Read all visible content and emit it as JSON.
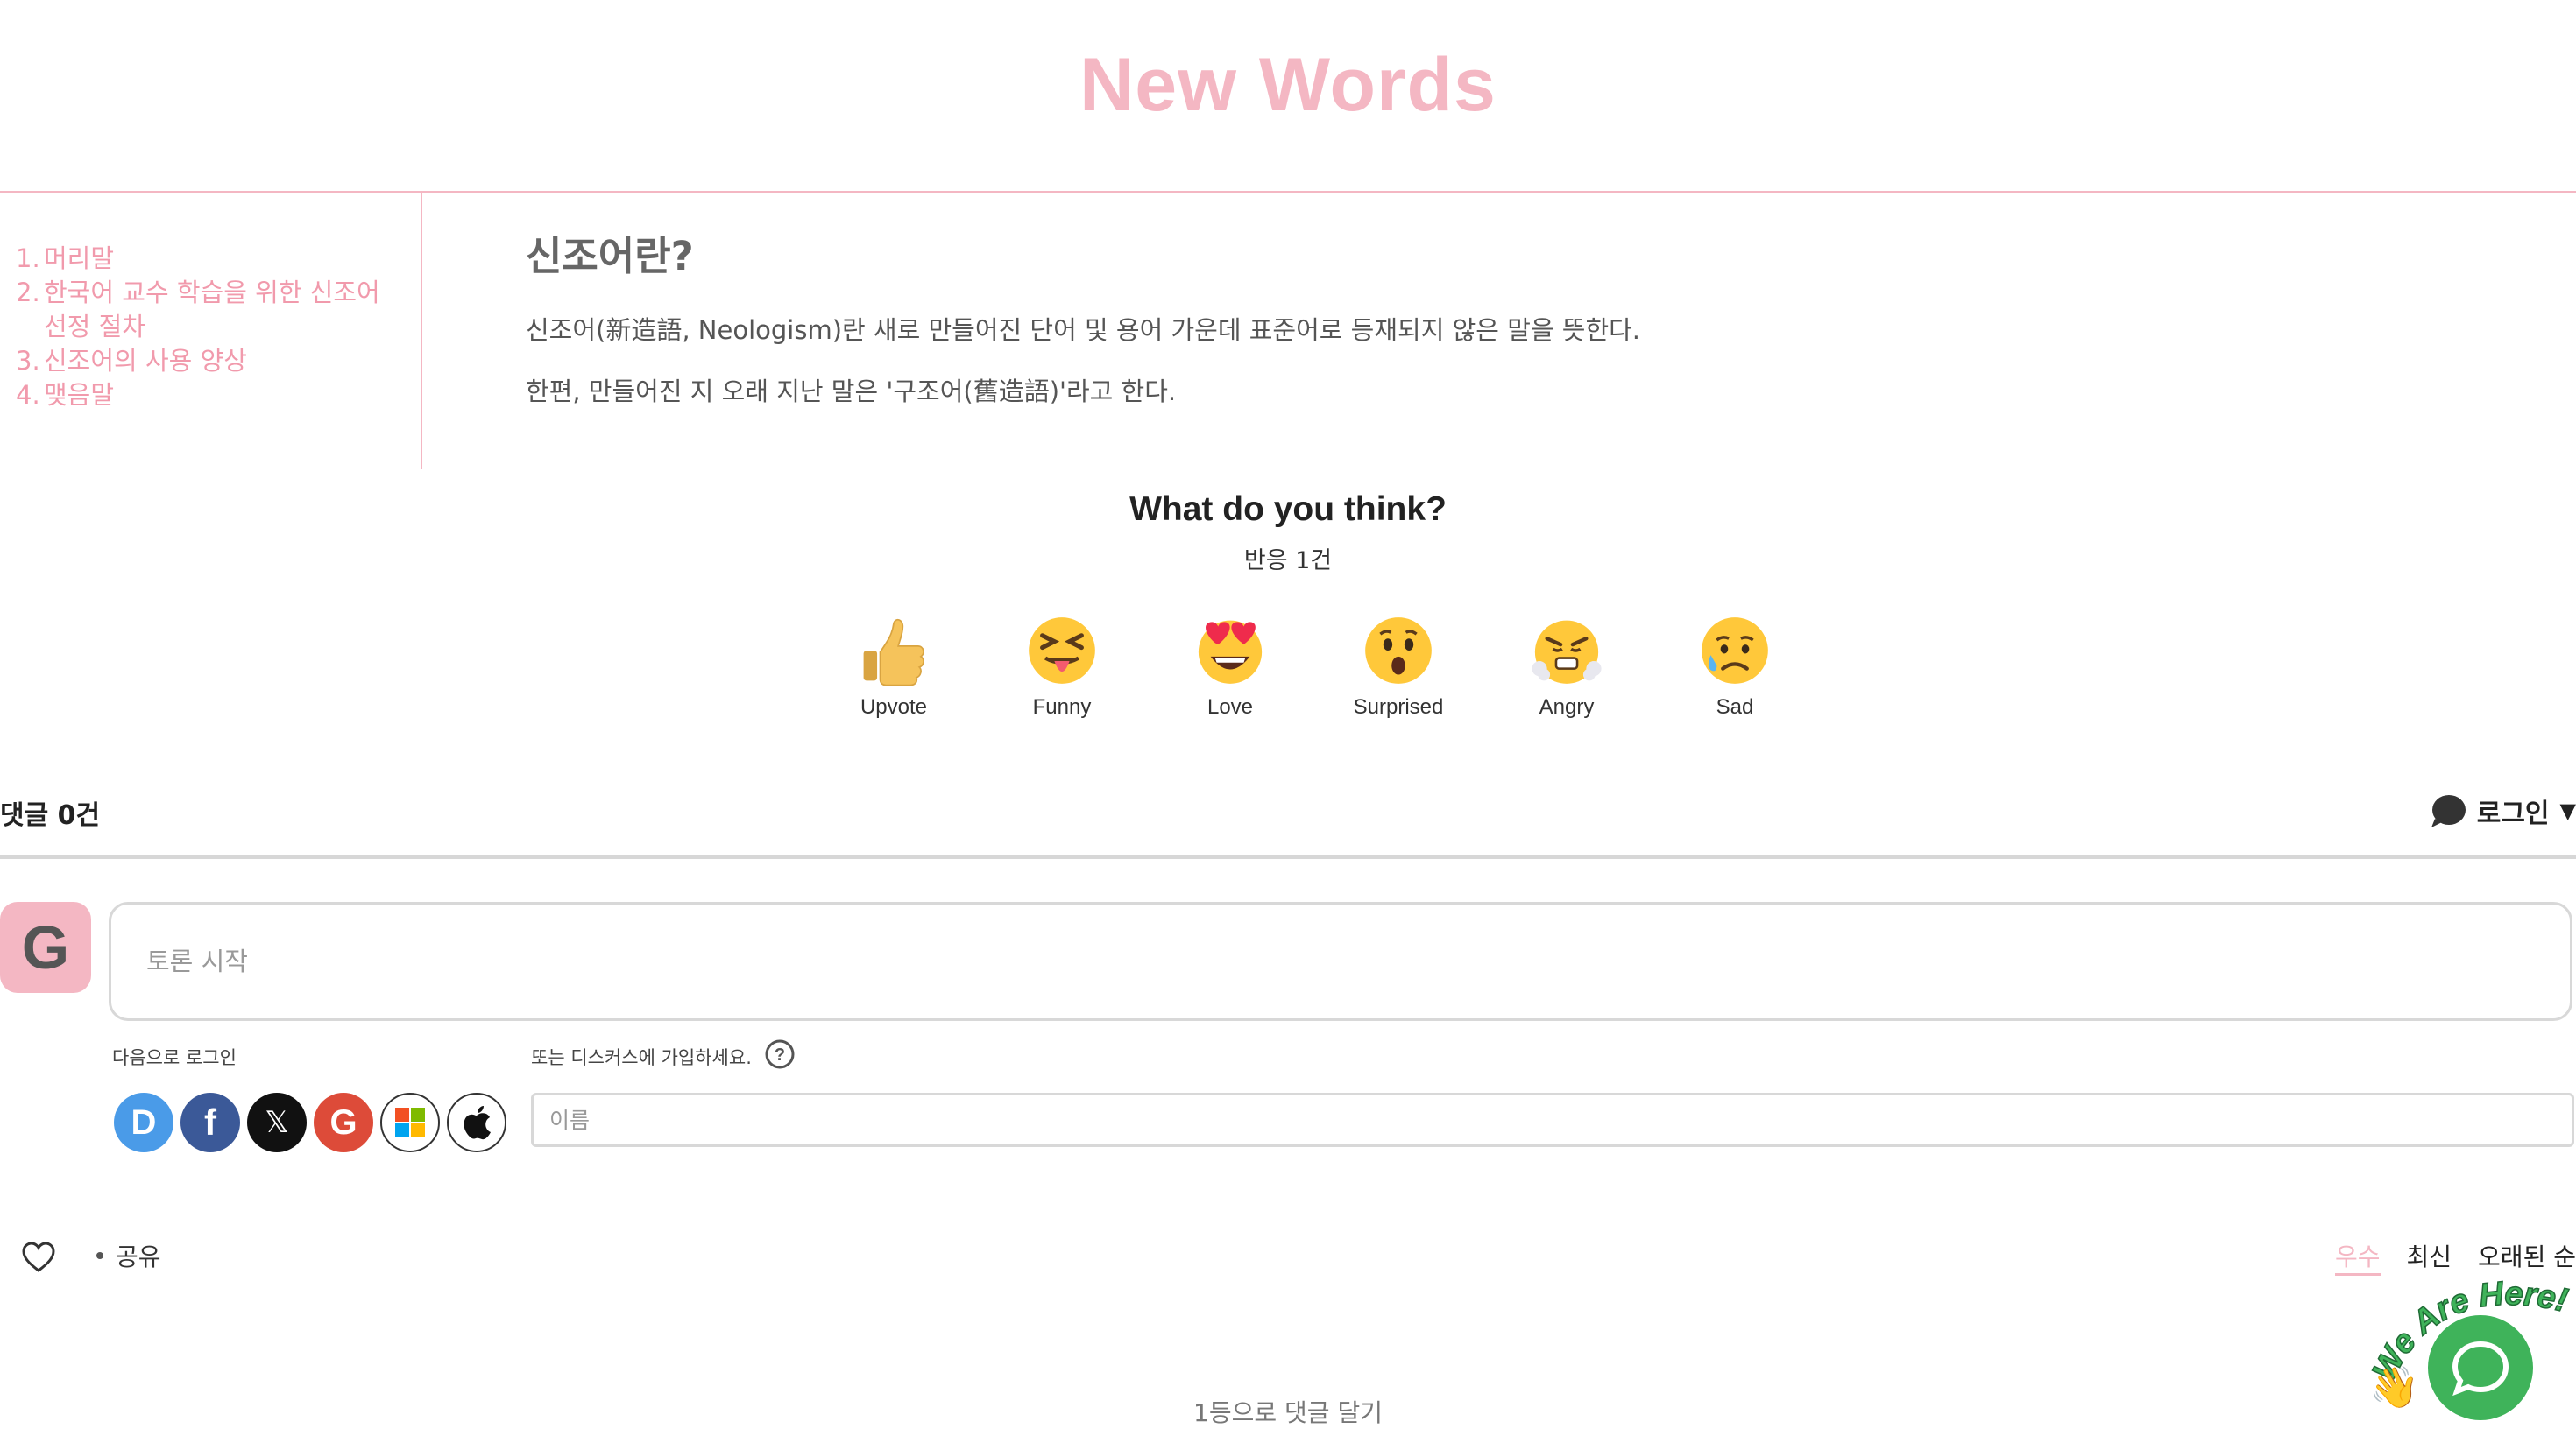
{
  "header": {
    "title": "New Words"
  },
  "toc": {
    "items": [
      {
        "num": "1.",
        "text": "머리말"
      },
      {
        "num": "2.",
        "text": "한국어 교수 학습을 위한 신조어 선정 절차"
      },
      {
        "num": "3.",
        "text": "신조어의 사용 양상"
      },
      {
        "num": "4.",
        "text": "맺음말"
      }
    ]
  },
  "article": {
    "title": "신조어란?",
    "paragraphs": [
      "신조어(新造語, Neologism)란 새로 만들어진 단어 및 용어 가운데 표준어로 등재되지 않은 말을 뜻한다.",
      "한편, 만들어진 지 오래 지난 말은 '구조어(舊造語)'라고 한다."
    ]
  },
  "reactions": {
    "question": "What do you think?",
    "count": "반응 1건",
    "items": [
      {
        "label": "Upvote",
        "icon": "thumbs-up-emoji"
      },
      {
        "label": "Funny",
        "icon": "tongue-out-emoji"
      },
      {
        "label": "Love",
        "icon": "heart-eyes-emoji"
      },
      {
        "label": "Surprised",
        "icon": "surprised-emoji"
      },
      {
        "label": "Angry",
        "icon": "angry-emoji"
      },
      {
        "label": "Sad",
        "icon": "sad-emoji"
      }
    ]
  },
  "comments": {
    "count": "댓글 0건",
    "login_label": "로그인",
    "avatar_letter": "G",
    "input_placeholder": "토론 시작",
    "login_with": "다음으로 로그인",
    "signup_text": "또는 디스커스에 가입하세요.",
    "help_symbol": "?",
    "name_placeholder": "이름",
    "share_label": "공유",
    "sort": {
      "best": "우수",
      "newest": "최신",
      "oldest": "오래된 순"
    },
    "first_comment": "1등으로 댓글 달기"
  },
  "social_logins": [
    {
      "name": "Disqus",
      "letter": "D",
      "color": "#4a9be8"
    },
    {
      "name": "Facebook",
      "letter": "f",
      "color": "#3b5998"
    },
    {
      "name": "X",
      "letter": "𝕏",
      "color": "#111111"
    },
    {
      "name": "Google",
      "letter": "G",
      "color": "#dd4b39"
    },
    {
      "name": "Microsoft",
      "letter": "",
      "color": "#ffffff"
    },
    {
      "name": "Apple",
      "letter": "",
      "color": "#ffffff"
    }
  ],
  "chat_widget": {
    "badge_text": "We Are Here!",
    "color": "#3fb35a"
  },
  "colors": {
    "accent": "#f4b7c3",
    "toc_text": "#f19aac"
  }
}
